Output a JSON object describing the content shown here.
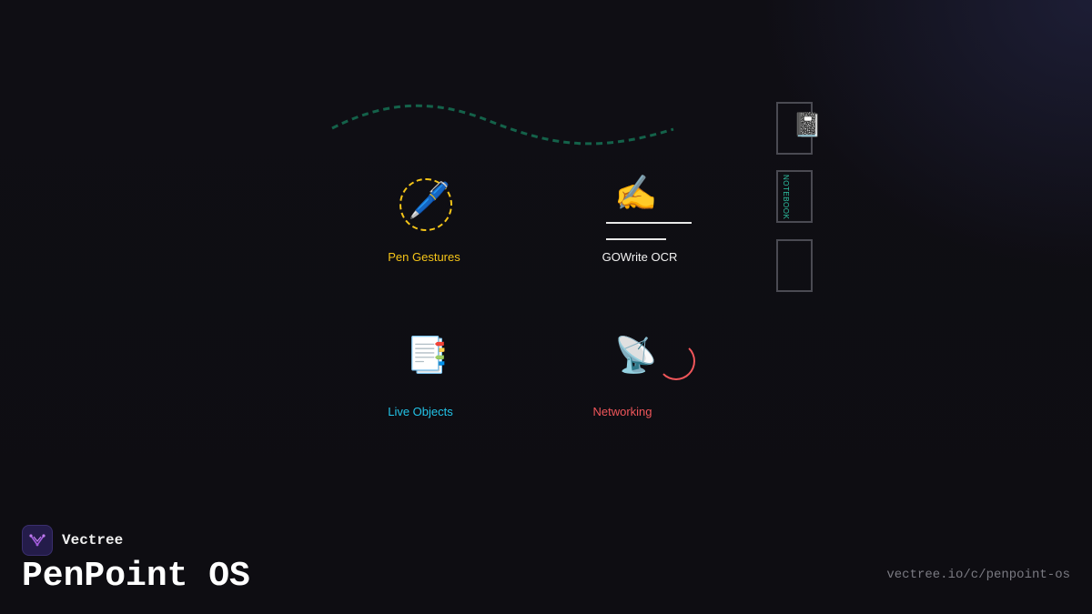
{
  "features": {
    "pen_gestures": {
      "icon": "pen-icon",
      "glyph": "🖊️",
      "label": "Pen Gestures",
      "color": "#f5c518"
    },
    "gowrite_ocr": {
      "icon": "writing-hand-icon",
      "glyph": "✍️",
      "label": "GOWrite OCR",
      "color": "#f2f2f2"
    },
    "live_objects": {
      "icon": "bookmark-tabs-icon",
      "glyph": "📑",
      "label": "Live Objects",
      "color": "#22c4e8"
    },
    "networking": {
      "icon": "satellite-antenna-icon",
      "glyph": "📡",
      "label": "Networking",
      "color": "#f0565a"
    }
  },
  "notebook_tabs": {
    "icon": "notebook-icon",
    "glyph": "📓",
    "section_label": "NOTEBOOK",
    "accent": "#2ec4a4"
  },
  "brand": {
    "logo_icon": "vectree-logo-icon",
    "name": "Vectree",
    "accent": "#a35ce0"
  },
  "title": "PenPoint OS",
  "url": "vectree.io/c/penpoint-os",
  "wave_color": "#14624a"
}
